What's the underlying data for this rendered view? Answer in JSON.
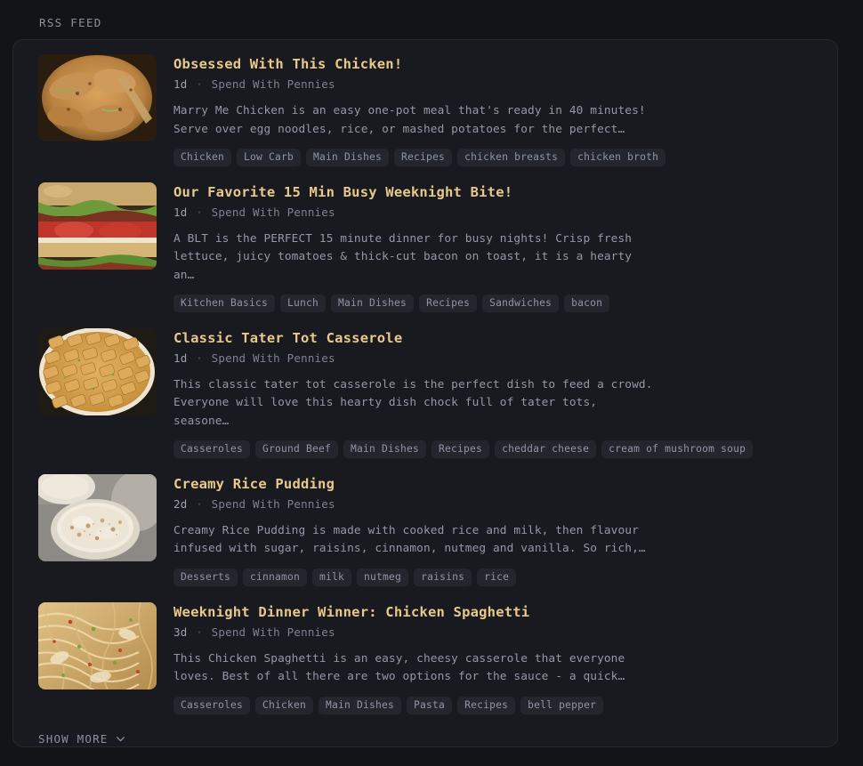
{
  "section": {
    "header": "RSS FEED"
  },
  "colors": {
    "page_bg": "#131417",
    "card_bg": "#191a1f",
    "card_border": "#26282f",
    "title": "#e8c98a",
    "meta": "#7c8293",
    "description": "#9298a8",
    "tag_bg": "#24262e",
    "tag_text": "#8f95a5",
    "header_text": "#8a8f9e"
  },
  "feed": {
    "entries": [
      {
        "title": "Obsessed With This Chicken!",
        "age": "1d",
        "separator": "·",
        "source": "Spend With Pennies",
        "description": "Marry Me Chicken is an easy one-pot meal that's ready in 40 minutes! Serve over egg noodles, rice, or mashed potatoes for the perfect…",
        "thumbnail": "creamy-chicken-skillet-photo",
        "tags": [
          "Chicken",
          "Low Carb",
          "Main Dishes",
          "Recipes",
          "chicken breasts",
          "chicken broth"
        ]
      },
      {
        "title": "Our Favorite 15 Min Busy Weeknight Bite!",
        "age": "1d",
        "separator": "·",
        "source": "Spend With Pennies",
        "description": "A BLT is the PERFECT 15 minute dinner for busy nights! Crisp fresh lettuce, juicy tomatoes & thick-cut bacon on toast, it is a hearty an…",
        "thumbnail": "blt-sandwich-photo",
        "tags": [
          "Kitchen Basics",
          "Lunch",
          "Main Dishes",
          "Recipes",
          "Sandwiches",
          "bacon"
        ]
      },
      {
        "title": "Classic Tater Tot Casserole",
        "age": "1d",
        "separator": "·",
        "source": "Spend With Pennies",
        "description": "This classic tater tot casserole is the perfect dish to feed a crowd. Everyone will love this hearty dish chock full of tater tots, seasone…",
        "thumbnail": "tater-tot-casserole-photo",
        "tags": [
          "Casseroles",
          "Ground Beef",
          "Main Dishes",
          "Recipes",
          "cheddar cheese",
          "cream of mushroom soup"
        ]
      },
      {
        "title": "Creamy Rice Pudding",
        "age": "2d",
        "separator": "·",
        "source": "Spend With Pennies",
        "description": "Creamy Rice Pudding is made with cooked rice and milk, then flavour infused with sugar, raisins, cinnamon, nutmeg and vanilla. So rich,…",
        "thumbnail": "rice-pudding-bowl-photo",
        "tags": [
          "Desserts",
          "cinnamon",
          "milk",
          "nutmeg",
          "raisins",
          "rice"
        ]
      },
      {
        "title": "Weeknight Dinner Winner: Chicken Spaghetti",
        "age": "3d",
        "separator": "·",
        "source": "Spend With Pennies",
        "description": "This Chicken Spaghetti is an easy, cheesy casserole that everyone loves. Best of all there are two options for the sauce - a quick…",
        "thumbnail": "chicken-spaghetti-photo",
        "tags": [
          "Casseroles",
          "Chicken",
          "Main Dishes",
          "Pasta",
          "Recipes",
          "bell pepper"
        ]
      }
    ]
  },
  "footer": {
    "show_more_label": "SHOW MORE",
    "chevron_icon": "chevron-down-icon"
  }
}
